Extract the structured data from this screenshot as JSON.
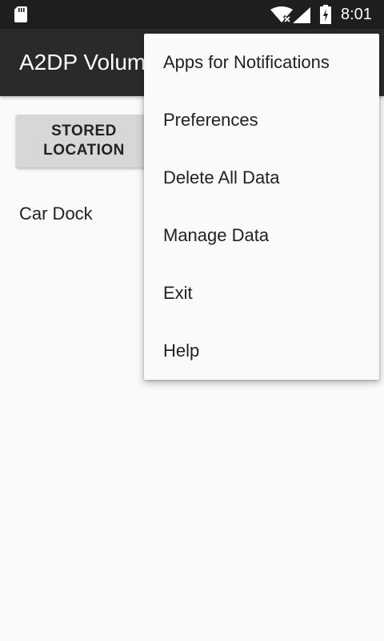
{
  "status_bar": {
    "time": "8:01",
    "icons": [
      "sd-card-icon",
      "wifi-icon",
      "signal-icon",
      "battery-charging-icon"
    ]
  },
  "app_bar": {
    "title": "A2DP Volum"
  },
  "content": {
    "stored_location_button": "STORED LOCATION",
    "list_items": [
      "Car Dock"
    ]
  },
  "overflow_menu": {
    "items": [
      "Apps for Notifications",
      "Preferences",
      "Delete All Data",
      "Manage Data",
      "Exit",
      "Help"
    ]
  },
  "colors": {
    "status_bar": "#1e1e1e",
    "app_bar": "#2a2a2a",
    "background": "#fafafa",
    "button": "#d6d7d7",
    "text": "#222222"
  }
}
